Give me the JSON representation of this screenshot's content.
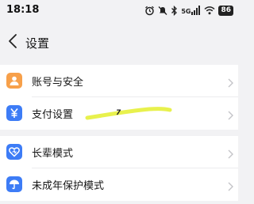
{
  "status_bar": {
    "time": "18:18",
    "signal_label": "5G",
    "battery": "86",
    "icons": [
      "alarm-icon",
      "mute-icon",
      "bluetooth-icon",
      "signal-icon",
      "wifi-icon",
      "battery-icon"
    ]
  },
  "nav": {
    "back_icon": "chevron-left-icon",
    "title": "设置"
  },
  "groups": [
    {
      "items": [
        {
          "label": "账号与安全",
          "icon": "person-icon",
          "icon_color": "#f7a04a"
        },
        {
          "label": "支付设置",
          "icon": "yen-icon",
          "icon_color": "#3d7cf6"
        }
      ]
    },
    {
      "items": [
        {
          "label": "长辈模式",
          "icon": "heart-icon",
          "icon_color": "#3d7cf6"
        },
        {
          "label": "未成年保护模式",
          "icon": "umbrella-icon",
          "icon_color": "#3d7cf6"
        }
      ]
    }
  ],
  "annotation": {
    "mark": "7",
    "color": "#e6f03a"
  },
  "colors": {
    "background": "#f2f2f4",
    "card": "#ffffff",
    "chevron": "#c4c4c8"
  }
}
